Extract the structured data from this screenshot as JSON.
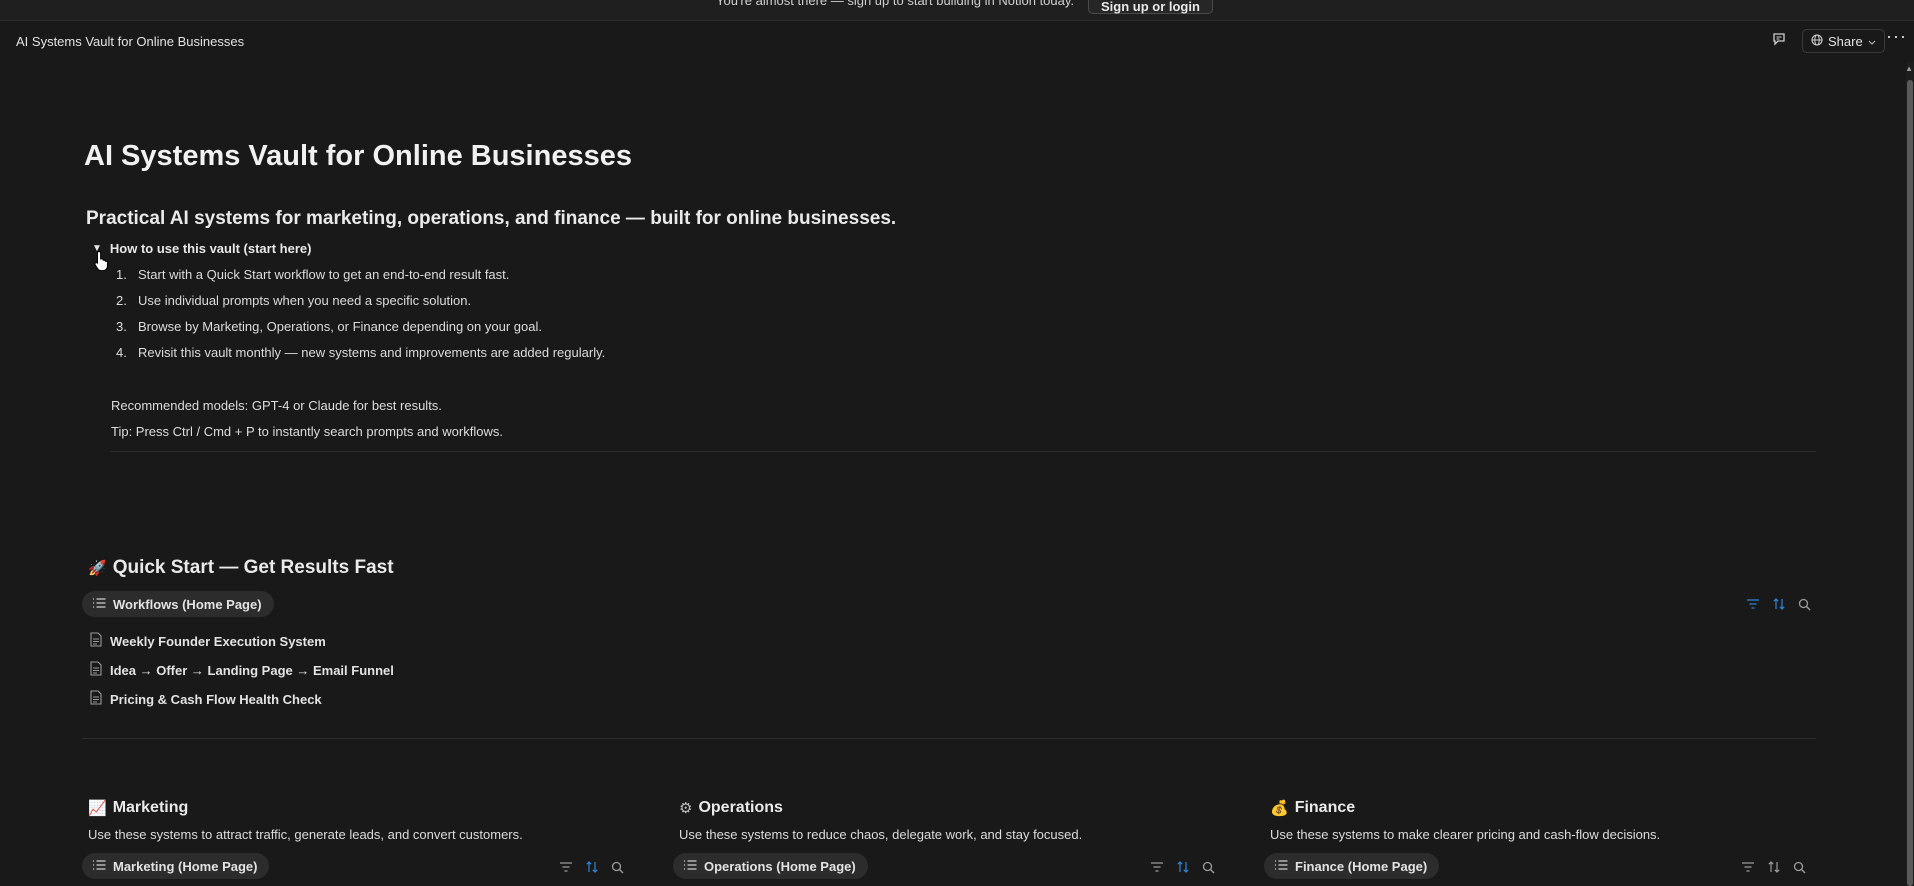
{
  "banner": {
    "text": "You're almost there — sign up to start building in Notion today.",
    "button": "Sign up or login"
  },
  "topbar": {
    "title": "AI Systems Vault for Online Businesses",
    "share_label": "Share",
    "more_label": "···"
  },
  "page": {
    "title": "AI Systems Vault for Online Businesses",
    "subtitle": "Practical AI systems for marketing, operations, and finance — built for online businesses."
  },
  "toggle": {
    "label": "How to use this vault (start here)",
    "arrow": "▼",
    "steps": [
      {
        "num": "1.",
        "text": "Start with a Quick Start workflow to get an end-to-end result fast."
      },
      {
        "num": "2.",
        "text": "Use individual prompts when you need a specific solution."
      },
      {
        "num": "3.",
        "text": "Browse by Marketing, Operations, or Finance depending on your goal."
      },
      {
        "num": "4.",
        "text": "Revisit this vault monthly — new systems and improvements are added regularly."
      }
    ],
    "note1": "Recommended models: GPT-4 or Claude for best results.",
    "note2": "Tip: Press Ctrl / Cmd + P to instantly search prompts and workflows."
  },
  "quick_start": {
    "emoji": "🚀",
    "heading": "Quick Start — Get Results Fast",
    "view_label": "Workflows (Home Page)",
    "items": [
      "Weekly Founder Execution System",
      "Idea → Offer → Landing Page → Email Funnel",
      "Pricing & Cash Flow Health Check"
    ]
  },
  "columns": [
    {
      "emoji": "📈",
      "heading": "Marketing",
      "description": "Use these systems to attract traffic, generate leads, and convert customers.",
      "view_label": "Marketing (Home Page)"
    },
    {
      "emoji": "⚙",
      "heading": "Operations",
      "description": "Use these systems to reduce chaos, delegate work, and stay focused.",
      "view_label": "Operations (Home Page)"
    },
    {
      "emoji": "💰",
      "heading": "Finance",
      "description": "Use these systems to make clearer pricing and cash-flow decisions.",
      "view_label": "Finance (Home Page)"
    }
  ]
}
